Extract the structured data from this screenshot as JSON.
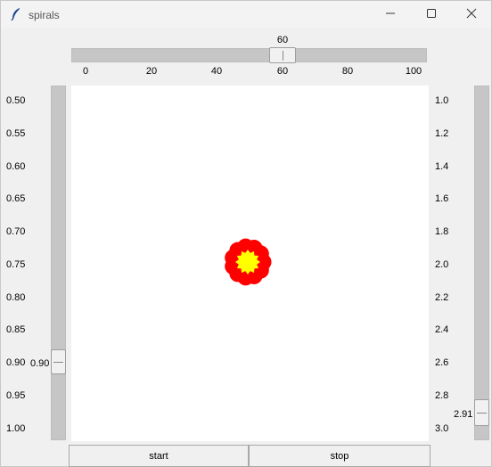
{
  "window": {
    "title": "spirals",
    "icons": [
      "feather-icon",
      "minimize-icon",
      "maximize-icon",
      "close-icon"
    ]
  },
  "top_scale": {
    "value": "60",
    "level": 60,
    "range": [
      0,
      100
    ],
    "ticks": [
      "0",
      "20",
      "40",
      "60",
      "80",
      "100"
    ]
  },
  "left_scale": {
    "value": "0.90",
    "level": 0.9,
    "range": [
      0.5,
      1.0
    ],
    "ticks": [
      "0.50",
      "0.55",
      "0.60",
      "0.65",
      "0.70",
      "0.75",
      "0.80",
      "0.85",
      "0.90",
      "0.95",
      "1.00"
    ]
  },
  "right_scale": {
    "value": "2.91",
    "level": 2.91,
    "range": [
      1.0,
      3.0
    ],
    "ticks": [
      "1.0",
      "1.2",
      "1.4",
      "1.6",
      "1.8",
      "2.0",
      "2.2",
      "2.4",
      "2.6",
      "2.8",
      "3.0"
    ]
  },
  "canvas": {
    "shape": "spiral-flower",
    "colors": {
      "outer": "#ff0000",
      "inner": "#ffff00",
      "background": "#ffffff"
    }
  },
  "buttons": {
    "start_label": "start",
    "stop_label": "stop"
  }
}
